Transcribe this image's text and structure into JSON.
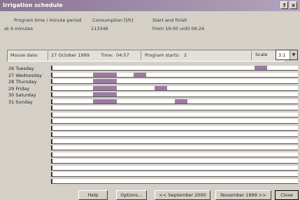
{
  "window": {
    "title": "Irrigation schedule",
    "help_glyph": "?",
    "close_glyph": "×"
  },
  "info": {
    "program_time_label": "Program time / minute period",
    "program_time_value": "at 4 minutes",
    "consumption_label": "Consumption [l/h]",
    "consumption_value": "113346",
    "start_finish_label": "Start and finish",
    "start_finish_value": "From 19:00 until 06:24"
  },
  "status": {
    "mouse_date_label": "Mouse date:",
    "mouse_date_value": "27 October 1999",
    "time_label": "Time:",
    "time_value": "04:57",
    "program_starts_label": "Program starts:",
    "program_starts_value": "2"
  },
  "scale": {
    "label": "Scale",
    "value": "3:1"
  },
  "days": [
    {
      "label": "26 Tuesday",
      "blocks": [
        {
          "start": 0.82,
          "len": 0.05
        }
      ]
    },
    {
      "label": "27 Wednesday",
      "blocks": [
        {
          "start": 0.165,
          "len": 0.095
        },
        {
          "start": 0.33,
          "len": 0.05
        }
      ]
    },
    {
      "label": "28 Thursday",
      "blocks": [
        {
          "start": 0.165,
          "len": 0.095
        }
      ]
    },
    {
      "label": "29 Friday",
      "blocks": [
        {
          "start": 0.165,
          "len": 0.095
        },
        {
          "start": 0.415,
          "len": 0.05
        }
      ]
    },
    {
      "label": "30 Saturday",
      "blocks": [
        {
          "start": 0.165,
          "len": 0.095
        }
      ]
    },
    {
      "label": "31 Sunday",
      "blocks": [
        {
          "start": 0.165,
          "len": 0.095
        },
        {
          "start": 0.495,
          "len": 0.05
        }
      ]
    },
    {
      "label": "",
      "blocks": []
    },
    {
      "label": "",
      "blocks": []
    },
    {
      "label": "",
      "blocks": []
    },
    {
      "label": "",
      "blocks": []
    },
    {
      "label": "",
      "blocks": []
    },
    {
      "label": "",
      "blocks": []
    },
    {
      "label": "",
      "blocks": []
    },
    {
      "label": "",
      "blocks": []
    },
    {
      "label": "",
      "blocks": []
    },
    {
      "label": "",
      "blocks": []
    },
    {
      "label": "",
      "blocks": []
    },
    {
      "label": "",
      "blocks": []
    }
  ],
  "buttons": {
    "help": "Help",
    "options": "Options...",
    "prev_month": "<< September 2000",
    "next_month": "November 1999 >>",
    "close": "Close"
  },
  "colors": {
    "program_block": "#9b7ba3",
    "titlebar": "#8a7594"
  }
}
